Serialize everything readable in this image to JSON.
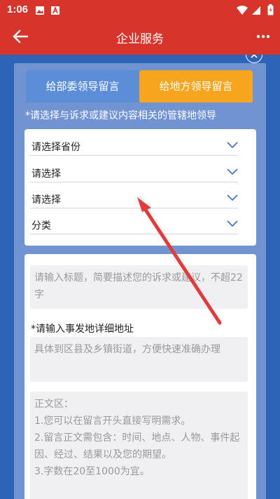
{
  "status_bar": {
    "time": "1:06",
    "left_icons": [
      "image-icon",
      "text-a-icon"
    ],
    "right_icons": [
      "wifi-icon",
      "signal-icon",
      "battery-icon"
    ]
  },
  "app_bar": {
    "title": "企业服务",
    "back_icon": "arrow-left-icon",
    "menu_icon": "more-dots-icon"
  },
  "tabs": [
    {
      "label": "给部委领导留言",
      "selected": false
    },
    {
      "label": "给地方领导留言",
      "selected": true
    }
  ],
  "hint": "*请选择与诉求或建议内容相关的管辖地领导",
  "selects": [
    {
      "label": "请选择省份"
    },
    {
      "label": "请选择"
    },
    {
      "label": "请选择"
    },
    {
      "label": "分类"
    }
  ],
  "form": {
    "title_placeholder": "请输入标题，简要描述您的诉求或建议，不超22字",
    "address_label": "*请输入事发地详细地址",
    "address_placeholder": "具体到区县及乡镇街道，方便快速准确办理",
    "body_placeholder": "正文区：\n1.您可以在留言开头直接写明需求。\n2.留言正文需包含：时间、地点、人物、事件起因、经过、结果以及您的期望。\n3.字数在20至1000为宜。"
  },
  "colors": {
    "header": "#d7352b",
    "background": "#2e64b7",
    "tab_inactive": "#5c8ed8",
    "tab_active": "#f7a51f",
    "annotation_arrow": "#e23b3b"
  }
}
